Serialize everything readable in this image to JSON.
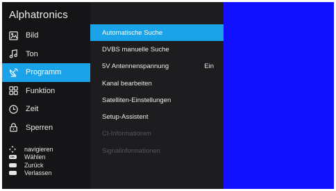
{
  "brand": "Alphatronics",
  "menu": {
    "items": [
      {
        "label": "Bild",
        "icon": "picture-icon"
      },
      {
        "label": "Ton",
        "icon": "music-note-icon"
      },
      {
        "label": "Programm",
        "icon": "satellite-dish-icon"
      },
      {
        "label": "Funktion",
        "icon": "grid-icon"
      },
      {
        "label": "Zeit",
        "icon": "clock-icon"
      },
      {
        "label": "Sperren",
        "icon": "lock-icon"
      }
    ],
    "active_index": 2
  },
  "legend": [
    {
      "key": "dpad-icon",
      "label": "navigieren"
    },
    {
      "key": "ok-key-icon",
      "label": "Wählen"
    },
    {
      "key": "back-key-icon",
      "label": "Zurück"
    },
    {
      "key": "exit-key-icon",
      "label": "Verlassen"
    }
  ],
  "submenu": {
    "items": [
      {
        "label": "Automatische Suche",
        "value": "",
        "state": "active"
      },
      {
        "label": "DVBS manuelle Suche",
        "value": "",
        "state": "normal"
      },
      {
        "label": "5V Antennenspannung",
        "value": "Ein",
        "state": "normal"
      },
      {
        "label": "Kanal bearbeiten",
        "value": "",
        "state": "normal"
      },
      {
        "label": "Satelliten-Einstellungen",
        "value": "",
        "state": "normal"
      },
      {
        "label": "Setup-Assistent",
        "value": "",
        "state": "normal"
      },
      {
        "label": "CI-Informationen",
        "value": "",
        "state": "disabled"
      },
      {
        "label": "Signalinformationen",
        "value": "",
        "state": "disabled"
      }
    ]
  },
  "colors": {
    "accent": "#1aa3e8",
    "preview_background": "#1010ff",
    "sidebar_background": "#151518",
    "submenu_background": "#1d1d20",
    "disabled_text": "#55565a"
  }
}
